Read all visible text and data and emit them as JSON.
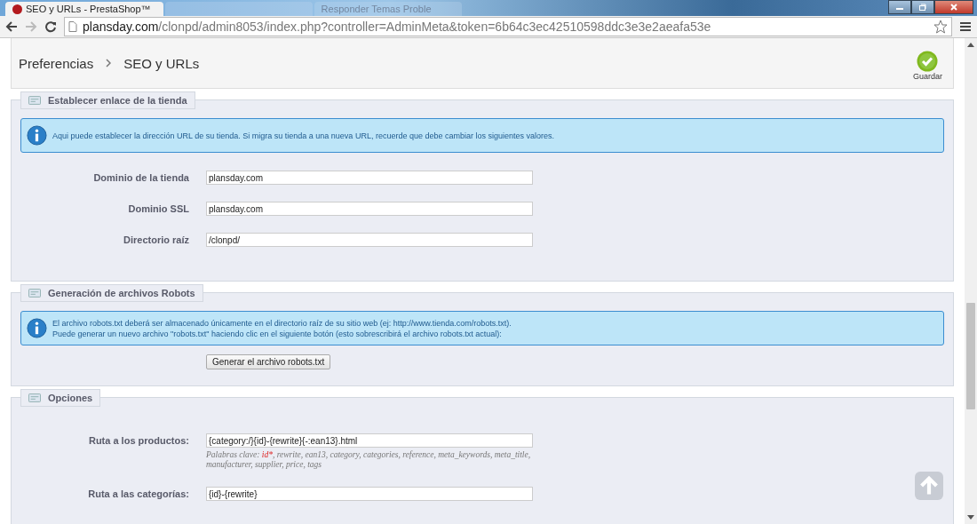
{
  "browser": {
    "tabs": [
      {
        "title": "SEO y URLs - PrestaShop™",
        "selected": true
      },
      {
        "selected": false
      },
      {
        "title": "Responder Temas Proble",
        "selected": false
      }
    ],
    "address": {
      "host": "plansday.com",
      "path": "/clonpd/admin8053/index.php?controller=AdminMeta&token=6b64c3ec42510598ddc3e3e2aeafa53e"
    }
  },
  "header": {
    "breadcrumb": [
      "Preferencias",
      "SEO y URLs"
    ],
    "save_label": "Guardar"
  },
  "sections": [
    {
      "title": "Establecer enlace de la tienda",
      "info": [
        "Aqui puede establecer la dirección URL de su tienda. Si migra su tienda a una nueva URL, recuerde que debe cambiar los siguientes valores."
      ],
      "fields": [
        {
          "label": "Dominio de la tienda",
          "value": "plansday.com"
        },
        {
          "label": "Dominio SSL",
          "value": "plansday.com"
        },
        {
          "label": "Directorio raíz",
          "value": "/clonpd/"
        }
      ]
    },
    {
      "title": "Generación de archivos Robots",
      "info": [
        "El archivo robots.txt deberá ser almacenado únicamente en el directorio raíz de su sitio web (ej: http://www.tienda.com/robots.txt).",
        "Puede generar un nuevo archivo \"robots.txt\" haciendo clic en el siguiente botón (esto sobrescribirá el archivo robots.txt actual):"
      ],
      "button": "Generar el archivo robots.txt"
    },
    {
      "title": "Opciones",
      "fields": [
        {
          "label": "Ruta a los productos:",
          "value": "{category:/}{id}-{rewrite}{-:ean13}.html",
          "help": {
            "prefix": "Palabras clave:",
            "required_keyword": "id*",
            "rest": ", rewrite, ean13, category, categories, reference, meta_keywords, meta_title, manufacturer, supplier, price, tags"
          }
        },
        {
          "label": "Ruta a las categorías:",
          "value": "{id}-{rewrite}"
        }
      ]
    }
  ]
}
